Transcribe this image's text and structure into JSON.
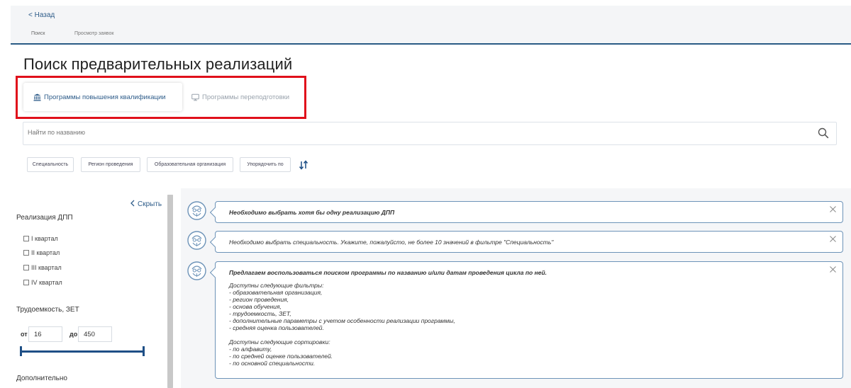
{
  "nav": {
    "back": "< Назад",
    "tabs": [
      {
        "label": "Поиск",
        "active": true
      },
      {
        "label": "Просмотр заявок",
        "active": false
      }
    ]
  },
  "page_title": "Поиск предварительных реализаций",
  "program_tabs": [
    {
      "label": "Программы повышения квалификации",
      "icon": "institution-icon",
      "active": true
    },
    {
      "label": "Программы переподготовки",
      "icon": "monitor-icon",
      "active": false
    }
  ],
  "search": {
    "placeholder": "Найти по названию",
    "value": ""
  },
  "filters": [
    {
      "label": "Специальность"
    },
    {
      "label": "Регион проведения"
    },
    {
      "label": "Образовательная организация"
    },
    {
      "label": "Упорядочить по"
    }
  ],
  "sidebar": {
    "hide_label": "Скрыть",
    "realization_heading": "Реализация ДПП",
    "quarters": [
      "I квартал",
      "II квартал",
      "III квартал",
      "IV квартал"
    ],
    "labor_heading": "Трудоемкость, ЗЕТ",
    "from_label": "от",
    "from_value": "16",
    "to_label": "до",
    "to_value": "450",
    "additional_heading": "Дополнительно"
  },
  "messages": [
    {
      "text": "Необходимо выбрать хотя бы одну реализацию ДПП",
      "bold": true
    },
    {
      "text": "Необходимо выбрать специальность. Укажите, пожалуйсто, не более 10 значений в фильтре \"Специальность\"",
      "bold": false
    },
    {
      "title": "Предлагаем воспользоваться поиском программы по названию и/или датам проведения цикла по ней.",
      "filters_heading": "Доступны следующие фильтры:",
      "filters": [
        "- образовательная организация,",
        "- регион проведения,",
        "- основа обучения,",
        "- трудоемкость, ЗЕТ,",
        "- дополнительные параметры с учетом особенности реализации программы,",
        "- средняя оценка пользователей."
      ],
      "sorts_heading": "Доступны следующие сортировки:",
      "sorts": [
        "- по алфавиту,",
        "- по средней оценке пользователей.",
        "- по основной специальности."
      ]
    }
  ],
  "colors": {
    "accent": "#2f5d8a",
    "highlight": "#e0101b",
    "slider": "#1e4f86",
    "message_border": "#6d93b8"
  }
}
